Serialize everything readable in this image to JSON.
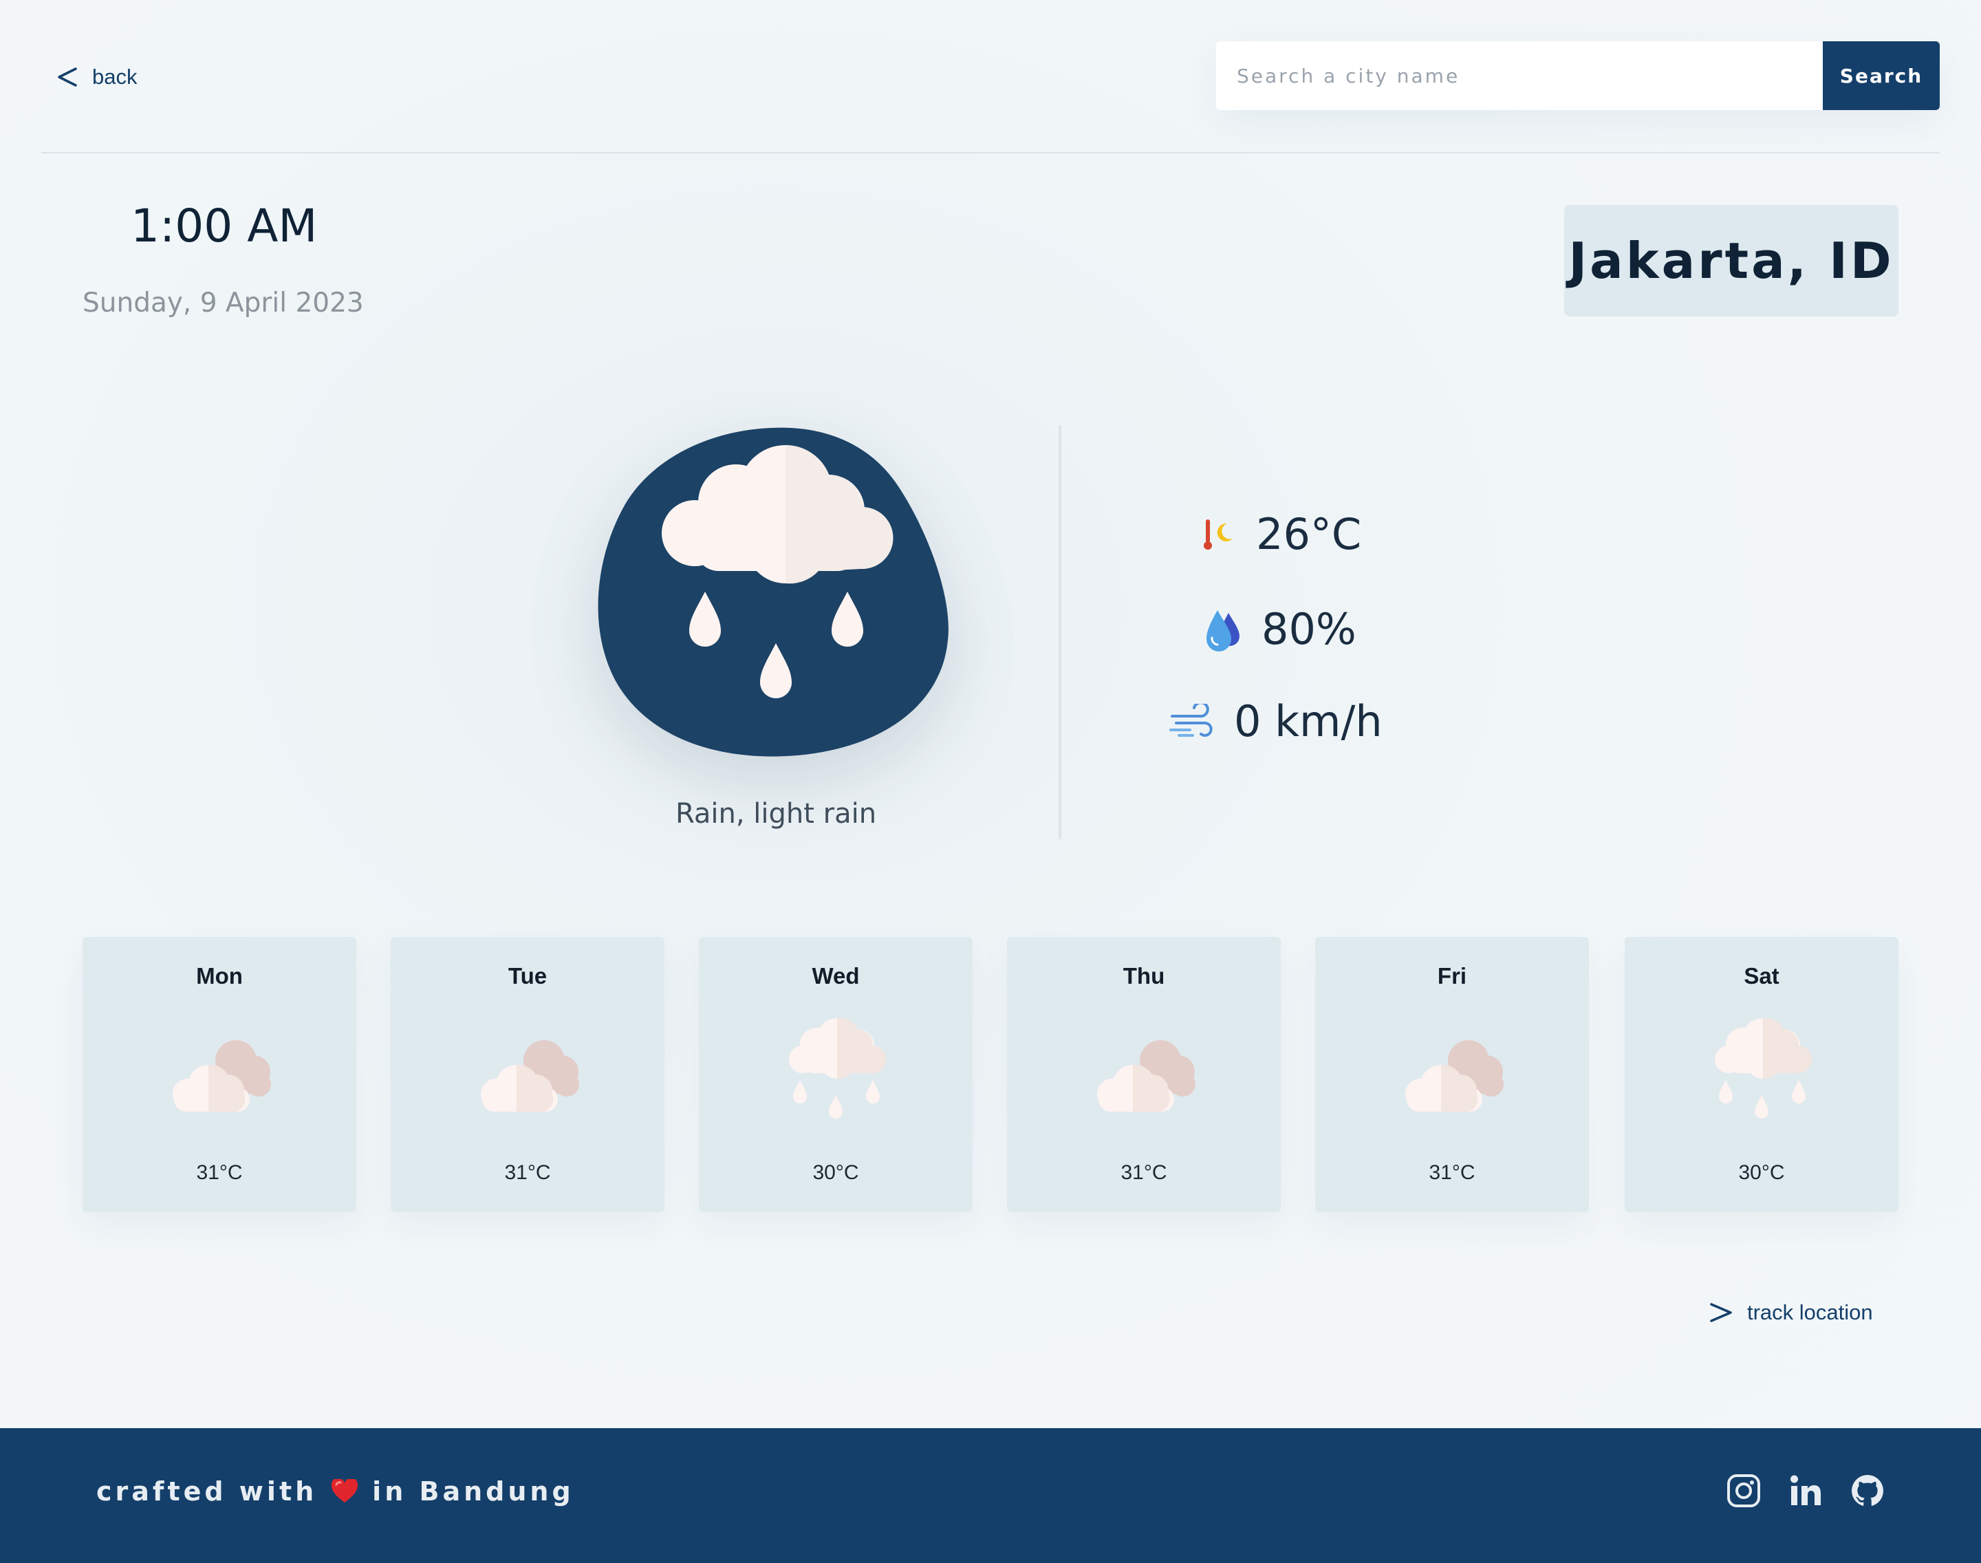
{
  "header": {
    "back_label": "back",
    "back_icon": "chevron-left-icon",
    "search_placeholder": "Search a city name",
    "search_value": "",
    "search_button_label": "Search"
  },
  "current": {
    "time": "1:00 AM",
    "date": "Sunday, 9 April 2023",
    "location": "Jakarta, ID",
    "condition": "Rain, light rain",
    "condition_icon": "rain-cloud-icon",
    "temperature": "26°C",
    "humidity": "80%",
    "wind": "0 km/h"
  },
  "forecast": [
    {
      "day": "Mon",
      "temp": "31°C",
      "icon": "cloudy-icon"
    },
    {
      "day": "Tue",
      "temp": "31°C",
      "icon": "cloudy-icon"
    },
    {
      "day": "Wed",
      "temp": "30°C",
      "icon": "rain-cloud-icon"
    },
    {
      "day": "Thu",
      "temp": "31°C",
      "icon": "cloudy-icon"
    },
    {
      "day": "Fri",
      "temp": "31°C",
      "icon": "cloudy-icon"
    },
    {
      "day": "Sat",
      "temp": "30°C",
      "icon": "rain-cloud-icon"
    }
  ],
  "track_label": "track location",
  "footer": {
    "text_before": "crafted with",
    "text_after": "in Bandung",
    "socials": [
      "instagram-icon",
      "linkedin-icon",
      "github-icon"
    ]
  },
  "colors": {
    "background": "#f1f6f8",
    "primary": "#143f6a",
    "card": "#dfeaef",
    "icon_blob": "#1c4266",
    "cloud": "#fbf3f0",
    "heart": "#e0262c"
  }
}
